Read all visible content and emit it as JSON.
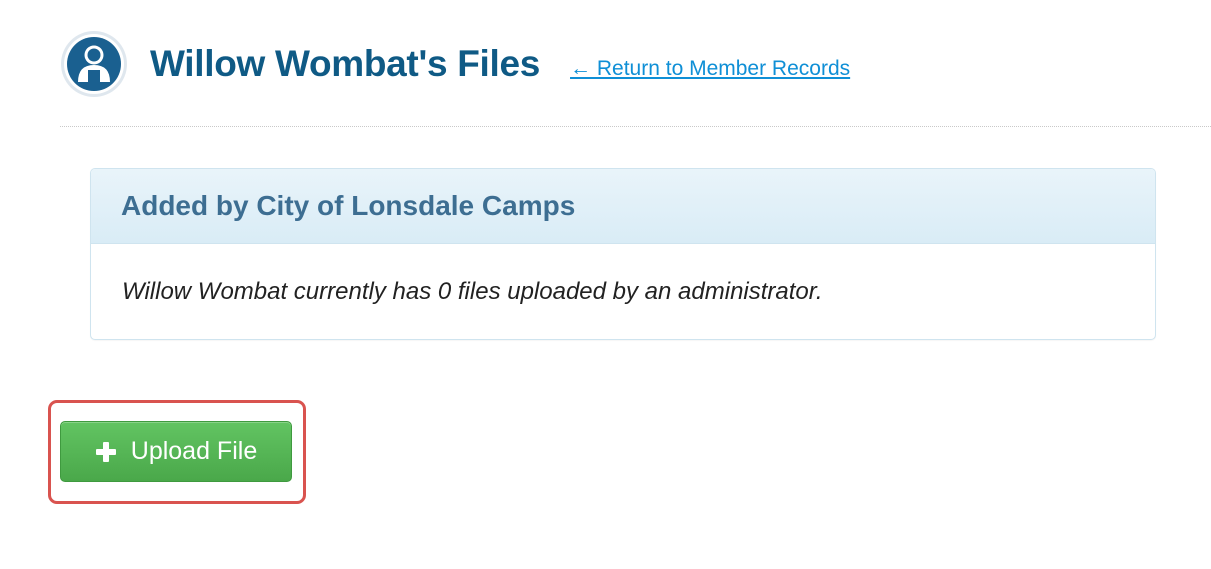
{
  "header": {
    "title": "Willow Wombat's Files",
    "return_link": "← Return to Member Records",
    "avatar_icon": "person-silhouette-icon"
  },
  "panel": {
    "title": "Added by City of Lonsdale Camps",
    "message": "Willow Wombat currently has 0 files uploaded by an administrator."
  },
  "actions": {
    "upload_label": "Upload File",
    "upload_icon": "plus-icon"
  },
  "colors": {
    "title": "#0f5a85",
    "link": "#0f8fd6",
    "panel_heading_bg": "#ddedf7",
    "panel_title": "#3d6e92",
    "button_green": "#57b957",
    "highlight_red": "#d9534f"
  }
}
